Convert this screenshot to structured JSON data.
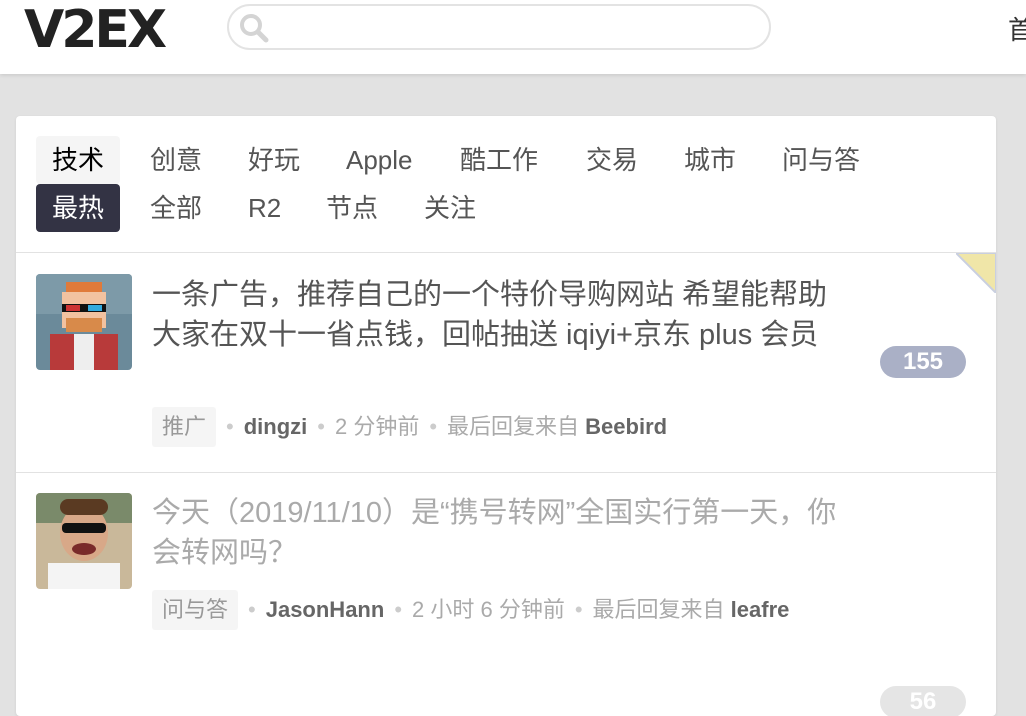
{
  "header": {
    "logo": "V2EX",
    "search": {
      "value": "",
      "placeholder": ""
    },
    "home_link": "首页"
  },
  "tabs_row1": [
    {
      "label": "技术",
      "state": "selected"
    },
    {
      "label": "创意"
    },
    {
      "label": "好玩"
    },
    {
      "label": "Apple"
    },
    {
      "label": "酷工作"
    },
    {
      "label": "交易"
    },
    {
      "label": "城市"
    },
    {
      "label": "问与答"
    }
  ],
  "tabs_row2": [
    {
      "label": "最热",
      "state": "hot"
    },
    {
      "label": "全部"
    },
    {
      "label": "R2"
    },
    {
      "label": "节点"
    },
    {
      "label": "关注"
    }
  ],
  "topics": [
    {
      "title": "一条广告，推荐自己的一个特价导购网站 希望能帮助大家在双十一省点钱，回帖抽送 iqiyi+京东 plus 会员",
      "node": "推广",
      "author": "dingzi",
      "time": "2 分钟前",
      "last_reply_label": "最后回复来自",
      "last_reply_user": "Beebird",
      "replies": "155",
      "visited": false,
      "count_color": "#aab0c6"
    },
    {
      "title": "今天（2019/11/10）是“携号转网”全国实行第一天，你会转网吗？",
      "node": "问与答",
      "author": "JasonHann",
      "time": "2 小时 6 分钟前",
      "last_reply_label": "最后回复来自",
      "last_reply_user": "leafre",
      "replies": "56",
      "visited": true,
      "count_color": "#e5e5e5"
    }
  ],
  "colors": {
    "page_bg": "#e2e2e2",
    "hot_tab_bg": "#333344",
    "ribbon": "#f0e6a8"
  }
}
